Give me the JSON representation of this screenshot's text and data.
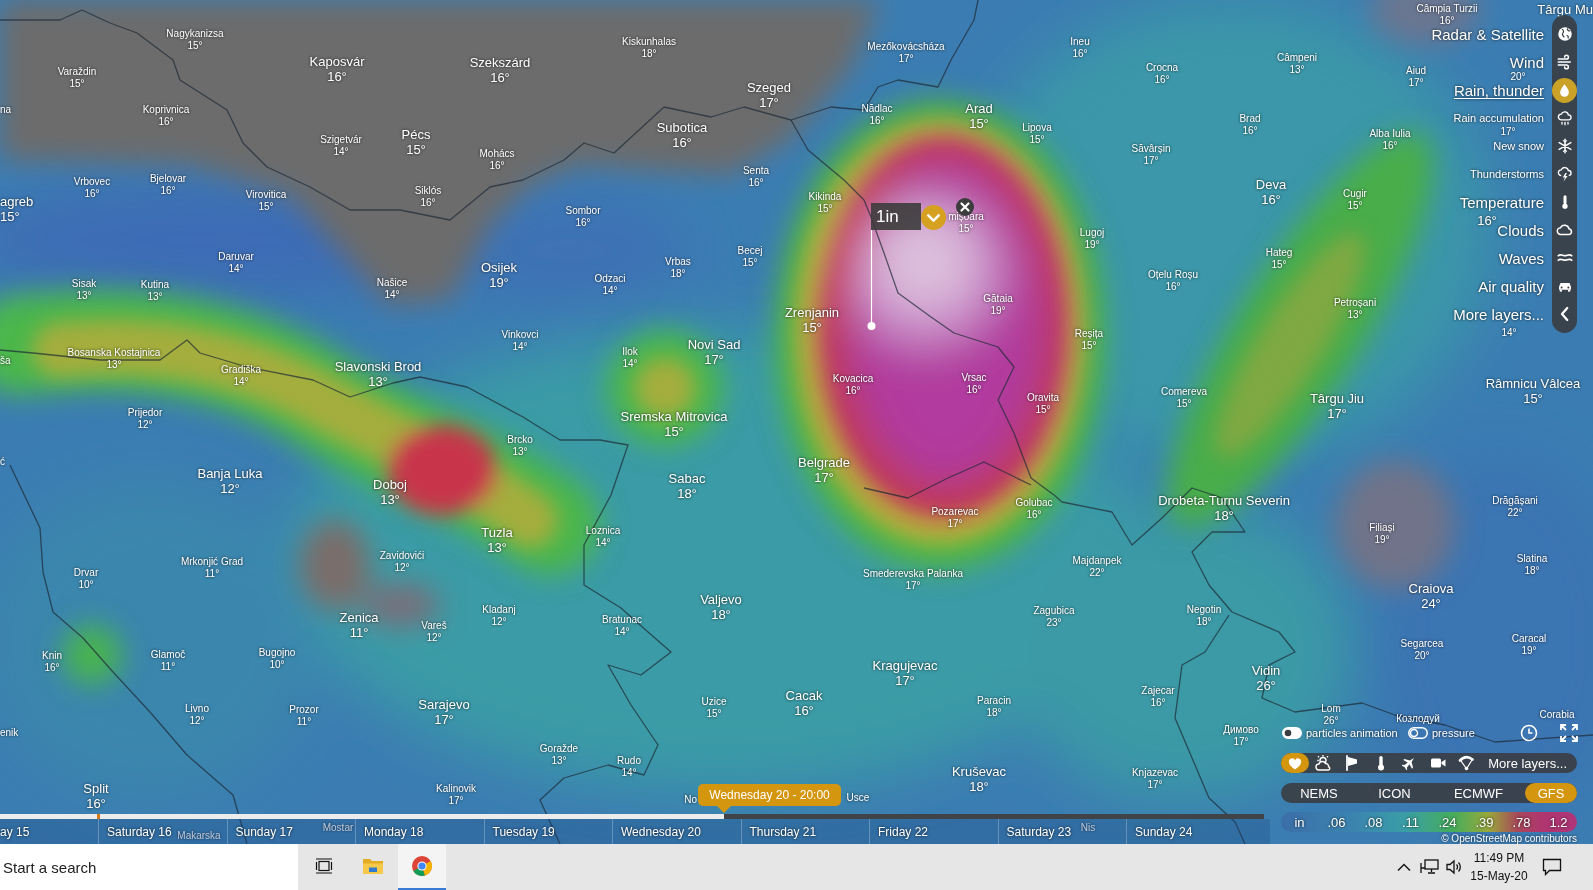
{
  "map": {
    "cities": [
      {
        "name": "Nagykanizsa",
        "temp": "15°",
        "kind": "minor"
      },
      {
        "name": "Varaždin",
        "temp": "15°",
        "kind": "minor"
      },
      {
        "name": "Kaposvár",
        "temp": "16°",
        "kind": "major"
      },
      {
        "name": "Szekszárd",
        "temp": "16°",
        "kind": "major"
      },
      {
        "name": "na",
        "kind": "minor"
      },
      {
        "name": "Koprivnica",
        "temp": "16°",
        "kind": "minor"
      },
      {
        "name": "Szigetvár",
        "temp": "14°",
        "kind": "minor"
      },
      {
        "name": "Pécs",
        "temp": "15°",
        "kind": "major"
      },
      {
        "name": "Mohács",
        "temp": "16°",
        "kind": "minor"
      },
      {
        "name": "Siklós",
        "temp": "16°",
        "kind": "minor"
      },
      {
        "name": "Vrbovec",
        "temp": "16°",
        "kind": "minor"
      },
      {
        "name": "Bjelovar",
        "temp": "16°",
        "kind": "minor"
      },
      {
        "name": "Virovitica",
        "temp": "15°",
        "kind": "minor"
      },
      {
        "name": "agreb",
        "temp": "15°",
        "kind": "major"
      },
      {
        "name": "Daruvar",
        "temp": "14°",
        "kind": "minor"
      },
      {
        "name": "Sisak",
        "temp": "13°",
        "kind": "minor"
      },
      {
        "name": "Kutina",
        "temp": "13°",
        "kind": "minor"
      },
      {
        "name": "Našice",
        "temp": "14°",
        "kind": "minor"
      },
      {
        "name": "Osijek",
        "temp": "19°",
        "kind": "major"
      },
      {
        "name": "Vinkovci",
        "temp": "14°",
        "kind": "minor"
      },
      {
        "name": "ša",
        "kind": "minor"
      },
      {
        "name": "Bosanska Kostajnica",
        "temp": "13°",
        "kind": "minor"
      },
      {
        "name": "Gradiška",
        "temp": "14°",
        "kind": "minor"
      },
      {
        "name": "Slavonski Brod",
        "temp": "13°",
        "kind": "major"
      },
      {
        "name": "Prijedor",
        "temp": "12°",
        "kind": "minor"
      },
      {
        "name": "Brcko",
        "temp": "13°",
        "kind": "minor"
      },
      {
        "name": "ć",
        "kind": "minor"
      },
      {
        "name": "Banja Luka",
        "temp": "12°",
        "kind": "major"
      },
      {
        "name": "Doboj",
        "temp": "13°",
        "kind": "major"
      },
      {
        "name": "Tuzla",
        "temp": "13°",
        "kind": "major"
      },
      {
        "name": "Zavidovići",
        "temp": "12°",
        "kind": "minor"
      },
      {
        "name": "Mrkonjić Grad",
        "temp": "11°",
        "kind": "minor"
      },
      {
        "name": "Drvar",
        "temp": "10°",
        "kind": "minor"
      },
      {
        "name": "Zenica",
        "temp": "11°",
        "kind": "major"
      },
      {
        "name": "Vareš",
        "temp": "12°",
        "kind": "minor"
      },
      {
        "name": "Kladanj",
        "temp": "12°",
        "kind": "minor"
      },
      {
        "name": "Knin",
        "temp": "16°",
        "kind": "minor"
      },
      {
        "name": "Glamoč",
        "temp": "11°",
        "kind": "minor"
      },
      {
        "name": "Bugojno",
        "temp": "10°",
        "kind": "minor"
      },
      {
        "name": "Livno",
        "temp": "12°",
        "kind": "minor"
      },
      {
        "name": "Prozor",
        "temp": "11°",
        "kind": "minor"
      },
      {
        "name": "Sarajevo",
        "temp": "17°",
        "kind": "major"
      },
      {
        "name": "enik",
        "kind": "minor"
      },
      {
        "name": "Split",
        "temp": "16°",
        "kind": "major"
      },
      {
        "name": "Kalinovik",
        "temp": "17°",
        "kind": "minor"
      },
      {
        "name": "Mostar",
        "kind": "minor"
      },
      {
        "name": "Makarska",
        "kind": "minor"
      },
      {
        "name": "Kiskunhalas",
        "temp": "18°",
        "kind": "minor"
      },
      {
        "name": "Mezőkovácsháza",
        "temp": "17°",
        "kind": "minor"
      },
      {
        "name": "Szeged",
        "temp": "17°",
        "kind": "major"
      },
      {
        "name": "Subotica",
        "temp": "16°",
        "kind": "major"
      },
      {
        "name": "Nădlac",
        "temp": "16°",
        "kind": "minor"
      },
      {
        "name": "Arad",
        "temp": "15°",
        "kind": "major"
      },
      {
        "name": "Lipova",
        "temp": "15°",
        "kind": "minor"
      },
      {
        "name": "Senta",
        "temp": "16°",
        "kind": "minor"
      },
      {
        "name": "Sombor",
        "temp": "16°",
        "kind": "minor"
      },
      {
        "name": "Kikinda",
        "temp": "15°",
        "kind": "minor"
      },
      {
        "name": "mișoara",
        "temp": "15°",
        "kind": "minor"
      },
      {
        "name": "Becej",
        "temp": "15°",
        "kind": "minor"
      },
      {
        "name": "Vrbas",
        "temp": "18°",
        "kind": "minor"
      },
      {
        "name": "Odzaci",
        "temp": "14°",
        "kind": "minor"
      },
      {
        "name": "Zrenjanin",
        "temp": "15°",
        "kind": "major"
      },
      {
        "name": "Gătaia",
        "temp": "19°",
        "kind": "minor"
      },
      {
        "name": "Ilok",
        "temp": "14°",
        "kind": "minor"
      },
      {
        "name": "Novi Sad",
        "temp": "17°",
        "kind": "major"
      },
      {
        "name": "Kovacica",
        "temp": "16°",
        "kind": "minor"
      },
      {
        "name": "Vrsac",
        "temp": "16°",
        "kind": "minor"
      },
      {
        "name": "Oravita",
        "temp": "15°",
        "kind": "minor"
      },
      {
        "name": "Sremska Mitrovica",
        "temp": "15°",
        "kind": "major"
      },
      {
        "name": "Câmpia Turzii",
        "temp": "16°",
        "kind": "minor"
      },
      {
        "name": "Târgu Mu",
        "kind": "major"
      },
      {
        "name": "Ineu",
        "temp": "16°",
        "kind": "minor"
      },
      {
        "name": "Crocna",
        "temp": "16°",
        "kind": "minor"
      },
      {
        "name": "Câmpeni",
        "temp": "13°",
        "kind": "minor"
      },
      {
        "name": "Aiud",
        "temp": "17°",
        "kind": "minor"
      },
      {
        "name": "Brad",
        "temp": "16°",
        "kind": "minor"
      },
      {
        "name": "Săvârșin",
        "temp": "17°",
        "kind": "minor"
      },
      {
        "name": "Alba Iulia",
        "temp": "16°",
        "kind": "minor"
      },
      {
        "name": "Deva",
        "temp": "16°",
        "kind": "major"
      },
      {
        "name": "Cugir",
        "temp": "15°",
        "kind": "minor"
      },
      {
        "name": "Lugoj",
        "temp": "19°",
        "kind": "minor"
      },
      {
        "name": "Hateg",
        "temp": "15°",
        "kind": "minor"
      },
      {
        "name": "Oțelu Roșu",
        "temp": "16°",
        "kind": "minor"
      },
      {
        "name": "Petroșani",
        "temp": "13°",
        "kind": "minor"
      },
      {
        "name": "Reșița",
        "temp": "15°",
        "kind": "minor"
      },
      {
        "name": "Comereva",
        "temp": "15°",
        "kind": "minor"
      },
      {
        "name": "Târgu Jiu",
        "temp": "17°",
        "kind": "major"
      },
      {
        "name": "Râmnicu Vâlcea",
        "temp": "15°",
        "kind": "major"
      },
      {
        "temp": "20°",
        "kind": "minor"
      },
      {
        "temp": "17°",
        "kind": "minor"
      },
      {
        "temp": "16°",
        "kind": "major"
      },
      {
        "temp": "14°",
        "kind": "minor"
      },
      {
        "name": "Belgrade",
        "temp": "17°",
        "kind": "major"
      },
      {
        "name": "Sabac",
        "temp": "18°",
        "kind": "major"
      },
      {
        "name": "Pozarevac",
        "temp": "17°",
        "kind": "minor"
      },
      {
        "name": "Golubac",
        "temp": "16°",
        "kind": "minor"
      },
      {
        "name": "Loznica",
        "temp": "14°",
        "kind": "minor"
      },
      {
        "name": "Smederevska Palanka",
        "temp": "17°",
        "kind": "minor"
      },
      {
        "name": "Valjevo",
        "temp": "18°",
        "kind": "major"
      },
      {
        "name": "Bratunac",
        "temp": "14°",
        "kind": "minor"
      },
      {
        "name": "Kragujevac",
        "temp": "17°",
        "kind": "major"
      },
      {
        "name": "Uzice",
        "temp": "15°",
        "kind": "minor"
      },
      {
        "name": "Cacak",
        "temp": "16°",
        "kind": "major"
      },
      {
        "name": "Paracin",
        "temp": "18°",
        "kind": "minor"
      },
      {
        "name": "Goražde",
        "temp": "13°",
        "kind": "minor"
      },
      {
        "name": "Rudo",
        "temp": "14°",
        "kind": "minor"
      },
      {
        "name": "Kruševac",
        "temp": "18°",
        "kind": "major"
      },
      {
        "name": "No",
        "kind": "minor"
      },
      {
        "name": "Usce",
        "kind": "minor"
      },
      {
        "name": "Drobeta-Turnu Severin",
        "temp": "18°",
        "kind": "major"
      },
      {
        "name": "Drăgășani",
        "temp": "22°",
        "kind": "minor"
      },
      {
        "name": "Filiași",
        "temp": "19°",
        "kind": "minor"
      },
      {
        "name": "Majdanpek",
        "temp": "22°",
        "kind": "minor"
      },
      {
        "name": "Slatina",
        "temp": "18°",
        "kind": "minor"
      },
      {
        "name": "Craiova",
        "temp": "24°",
        "kind": "major"
      },
      {
        "name": "Zagubica",
        "temp": "23°",
        "kind": "minor"
      },
      {
        "name": "Negotin",
        "temp": "18°",
        "kind": "minor"
      },
      {
        "name": "Segarcea",
        "temp": "20°",
        "kind": "minor"
      },
      {
        "name": "Caracal",
        "temp": "19°",
        "kind": "minor"
      },
      {
        "name": "Vidin",
        "temp": "26°",
        "kind": "major"
      },
      {
        "name": "Zajecar",
        "temp": "16°",
        "kind": "minor"
      },
      {
        "name": "Lom",
        "temp": "26°",
        "kind": "minor"
      },
      {
        "name": "Димово",
        "temp": "17°",
        "kind": "minor"
      },
      {
        "name": "Козлодуй",
        "kind": "minor"
      },
      {
        "name": "Corabia",
        "kind": "minor"
      },
      {
        "name": "Knjazevac",
        "temp": "17°",
        "kind": "minor"
      },
      {
        "name": "Nis",
        "kind": "minor"
      }
    ],
    "picker": {
      "value": "1in"
    }
  },
  "layers": [
    {
      "label": "Radar & Satellite",
      "kind": "main",
      "selected": false
    },
    {
      "label": "Wind",
      "kind": "main",
      "selected": false
    },
    {
      "label": "Rain, thunder",
      "kind": "main",
      "selected": true
    },
    {
      "label": "Rain accumulation",
      "kind": "sub",
      "selected": false
    },
    {
      "label": "New snow",
      "kind": "sub",
      "selected": false
    },
    {
      "label": "Thunderstorms",
      "kind": "sub",
      "selected": false
    },
    {
      "label": "Temperature",
      "kind": "main",
      "selected": false
    },
    {
      "label": "Clouds",
      "kind": "main",
      "selected": false
    },
    {
      "label": "Waves",
      "kind": "main",
      "selected": false
    },
    {
      "label": "Air quality",
      "kind": "main",
      "selected": false
    },
    {
      "label": "More layers...",
      "kind": "main",
      "selected": false
    }
  ],
  "map_controls": {
    "toggles": [
      {
        "label": "particles animation",
        "on": true
      },
      {
        "label": "pressure",
        "on": false
      }
    ],
    "overlays": [
      {
        "selected": true
      },
      {
        "selected": false
      },
      {
        "selected": false
      },
      {
        "selected": false
      },
      {
        "selected": false
      },
      {
        "selected": false
      },
      {
        "selected": false
      }
    ],
    "more_layers": "More layers...",
    "models": [
      {
        "label": "NEMS",
        "selected": false
      },
      {
        "label": "ICON",
        "selected": false
      },
      {
        "label": "ECMWF",
        "selected": false
      },
      {
        "label": "GFS",
        "selected": true
      }
    ],
    "legend": {
      "unit": "in",
      "values": [
        ".06",
        ".08",
        ".11",
        ".24",
        ".39",
        ".78",
        "1.2"
      ]
    },
    "attribution": "© OpenStreetMap contributors"
  },
  "timeline": {
    "days": [
      "ay 15",
      "Saturday 16",
      "Sunday 17",
      "Monday 18",
      "Tuesday 19",
      "Wednesday 20",
      "Thursday 21",
      "Friday 22",
      "Saturday 23",
      "Sunday 24"
    ],
    "level": 0.573,
    "tooltip": "Wednesday 20 - 20:00"
  },
  "taskbar": {
    "search": {
      "placeholder": "Start a search"
    },
    "apps": [
      {
        "selected": false
      },
      {
        "selected": false
      },
      {
        "selected": true
      }
    ],
    "time": "11:49 PM",
    "date": "15-May-20"
  }
}
